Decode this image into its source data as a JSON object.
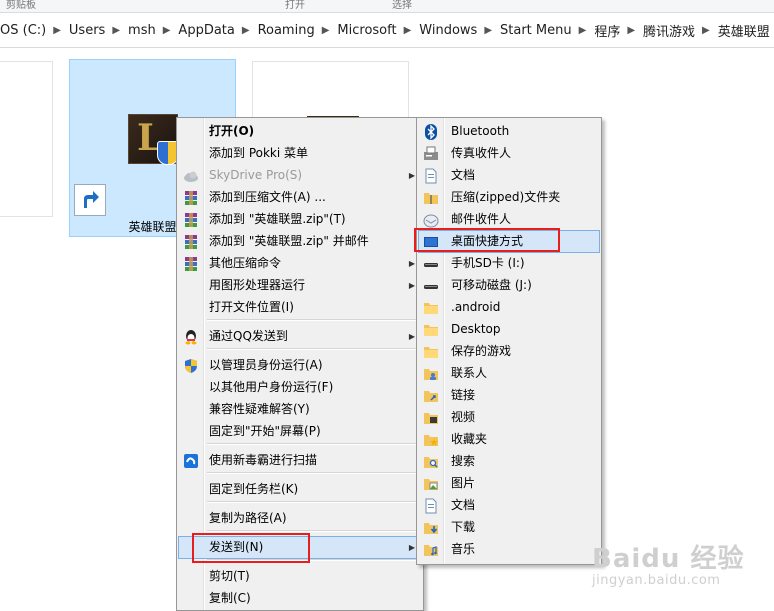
{
  "ribbon": {
    "labels": [
      "剪贴板",
      "打开",
      "选择"
    ]
  },
  "address": {
    "crumbs": [
      "OS (C:)",
      "Users",
      "msh",
      "AppData",
      "Roaming",
      "Microsoft",
      "Windows",
      "Start Menu",
      "程序",
      "腾讯游戏",
      "英雄联盟"
    ]
  },
  "tiles": {
    "selected_caption": "英雄联盟"
  },
  "context_menu": {
    "items": [
      {
        "label": "打开(O)"
      },
      {
        "label": "添加到 Pokki 菜单"
      },
      {
        "label": "SkyDrive Pro(S)"
      },
      {
        "label": "添加到压缩文件(A) ..."
      },
      {
        "label": "添加到 \"英雄联盟.zip\"(T)"
      },
      {
        "label": "添加到 \"英雄联盟.zip\" 并邮件"
      },
      {
        "label": "其他压缩命令"
      },
      {
        "label": "用图形处理器运行"
      },
      {
        "label": "打开文件位置(I)"
      },
      {
        "label": "通过QQ发送到"
      },
      {
        "label": "以管理员身份运行(A)"
      },
      {
        "label": "以其他用户身份运行(F)"
      },
      {
        "label": "兼容性疑难解答(Y)"
      },
      {
        "label": "固定到\"开始\"屏幕(P)"
      },
      {
        "label": "使用新毒霸进行扫描"
      },
      {
        "label": "固定到任务栏(K)"
      },
      {
        "label": "复制为路径(A)"
      },
      {
        "label": "发送到(N)"
      },
      {
        "label": "剪切(T)"
      },
      {
        "label": "复制(C)"
      }
    ]
  },
  "send_to_menu": {
    "items": [
      {
        "label": "Bluetooth",
        "icon": "bluetooth-icon"
      },
      {
        "label": "传真收件人",
        "icon": "fax-icon"
      },
      {
        "label": "文档",
        "icon": "document-icon"
      },
      {
        "label": "压缩(zipped)文件夹",
        "icon": "zip-folder-icon"
      },
      {
        "label": "邮件收件人",
        "icon": "mail-icon"
      },
      {
        "label": "桌面快捷方式",
        "icon": "desktop-icon"
      },
      {
        "label": "手机SD卡 (I:)",
        "icon": "drive-icon"
      },
      {
        "label": "可移动磁盘 (J:)",
        "icon": "drive-icon"
      },
      {
        "label": ".android",
        "icon": "folder-icon"
      },
      {
        "label": "Desktop",
        "icon": "folder-icon"
      },
      {
        "label": "保存的游戏",
        "icon": "folder-icon"
      },
      {
        "label": "联系人",
        "icon": "contacts-icon"
      },
      {
        "label": "链接",
        "icon": "links-icon"
      },
      {
        "label": "视频",
        "icon": "video-icon"
      },
      {
        "label": "收藏夹",
        "icon": "favorites-icon"
      },
      {
        "label": "搜索",
        "icon": "search-icon"
      },
      {
        "label": "图片",
        "icon": "pictures-icon"
      },
      {
        "label": "文档",
        "icon": "document-icon"
      },
      {
        "label": "下载",
        "icon": "download-icon"
      },
      {
        "label": "音乐",
        "icon": "music-icon"
      }
    ]
  },
  "watermark": {
    "brand": "Baidu 经验",
    "site": "jingyan.baidu.com"
  },
  "colors": {
    "highlight": "#d5e6f8",
    "highlight_border": "#7ab0e5",
    "annotation": "#e81e1e",
    "selection": "#cce8ff"
  }
}
